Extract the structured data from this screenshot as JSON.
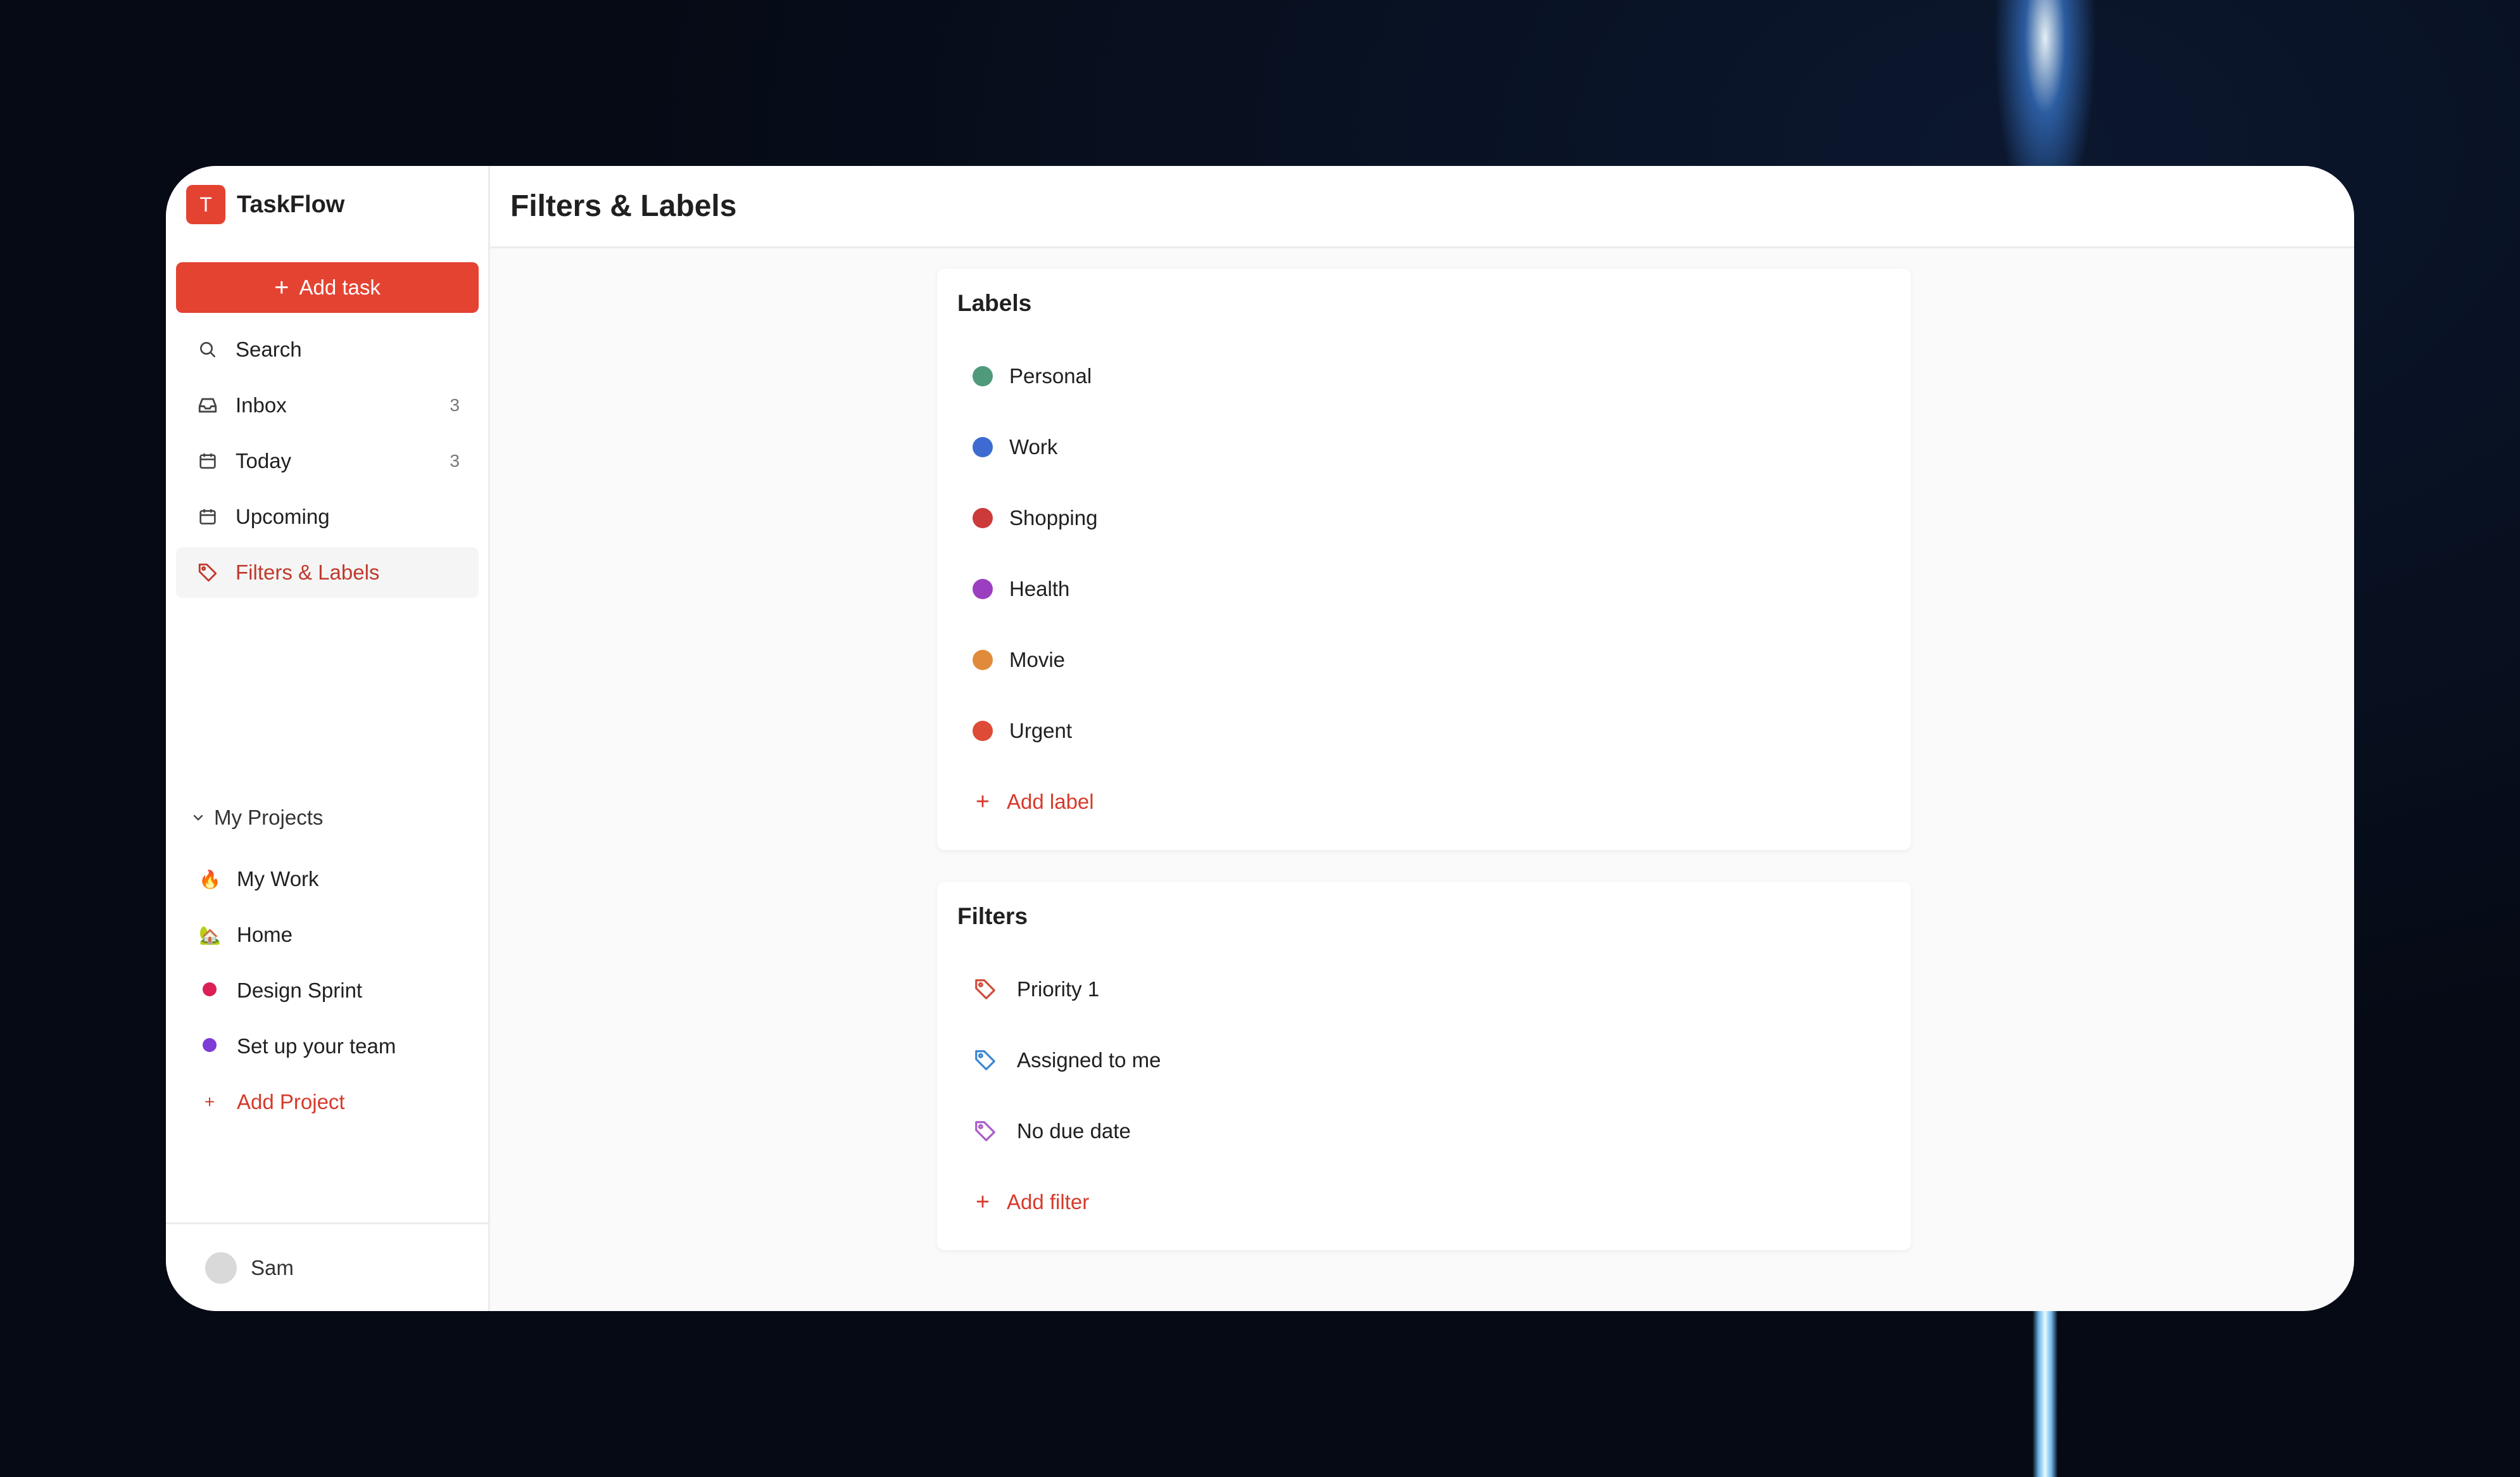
{
  "app": {
    "logo_letter": "T",
    "name": "TaskFlow"
  },
  "sidebar": {
    "add_task_label": "Add task",
    "nav": [
      {
        "label": "Search",
        "icon": "search-icon",
        "count": ""
      },
      {
        "label": "Inbox",
        "icon": "inbox-icon",
        "count": "3"
      },
      {
        "label": "Today",
        "icon": "calendar-icon",
        "count": "3"
      },
      {
        "label": "Upcoming",
        "icon": "calendar-icon",
        "count": ""
      },
      {
        "label": "Filters & Labels",
        "icon": "tag-icon",
        "count": "",
        "active": true
      }
    ],
    "projects_heading": "My Projects",
    "projects": [
      {
        "label": "My Work",
        "icon": "🔥"
      },
      {
        "label": "Home",
        "icon": "🏡"
      },
      {
        "label": "Design Sprint",
        "color": "#dc1f55"
      },
      {
        "label": "Set up your team",
        "color": "#7e3bd6"
      }
    ],
    "add_project_label": "Add Project",
    "user": {
      "name": "Sam"
    }
  },
  "main": {
    "title": "Filters & Labels",
    "labels_card": {
      "title": "Labels",
      "items": [
        {
          "label": "Personal",
          "color": "#4e9a7b"
        },
        {
          "label": "Work",
          "color": "#3d6bd1"
        },
        {
          "label": "Shopping",
          "color": "#cc3a3a"
        },
        {
          "label": "Health",
          "color": "#9b3fc0"
        },
        {
          "label": "Movie",
          "color": "#e08b3c"
        },
        {
          "label": "Urgent",
          "color": "#de4b36"
        }
      ],
      "add_label": "Add label"
    },
    "filters_card": {
      "title": "Filters",
      "items": [
        {
          "label": "Priority 1",
          "color": "#d24b3c"
        },
        {
          "label": "Assigned to me",
          "color": "#3c86d2"
        },
        {
          "label": "No due date",
          "color": "#a95cc9"
        }
      ],
      "add_label": "Add filter"
    }
  },
  "colors": {
    "accent": "#e44332"
  }
}
